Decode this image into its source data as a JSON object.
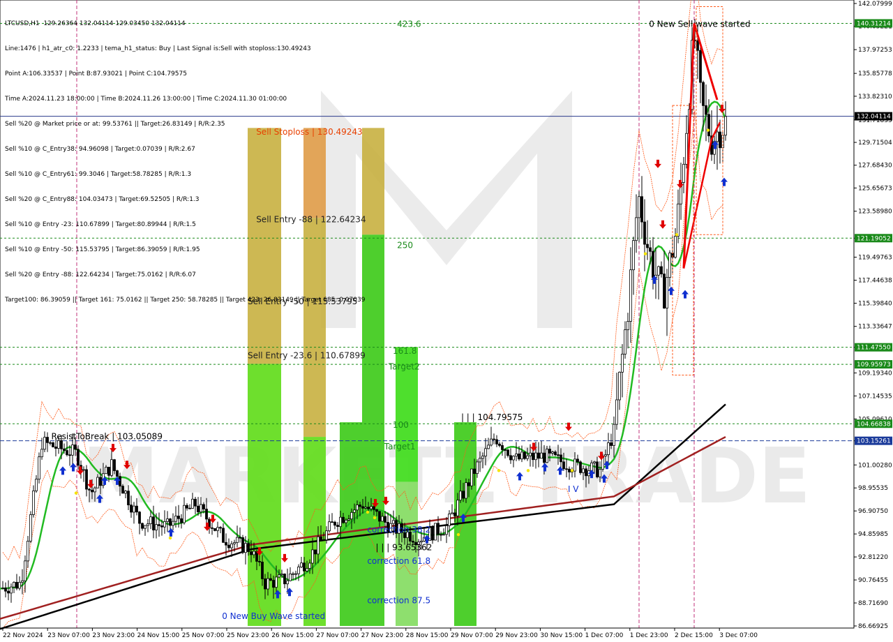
{
  "header": {
    "lines": [
      "LTCUSD,H1  129.26364 132.04114 129.03450 132.04114",
      "Line:1476 | h1_atr_c0: 1.2233 | tema_h1_status: Buy | Last Signal is:Sell with stoploss:130.49243",
      "Point A:106.33537 | Point B:87.93021 | Point C:104.79575",
      "Time A:2024.11.23 18:00:00 | Time B:2024.11.26 13:00:00 | Time C:2024.11.30 01:00:00",
      "Sell %20 @ Market price or at: 99.53761 || Target:26.83149 | R/R:2.35",
      "Sell %10 @ C_Entry38: 94.96098 | Target:0.07039 | R/R:2.67",
      "Sell %10 @ C_Entry61: 99.3046 | Target:58.78285 | R/R:1.3",
      "Sell %20 @ C_Entry88: 104.03473 | Target:69.52505 | R/R:1.3",
      "Sell %10 @ Entry -23: 110.67899 | Target:80.89944 | R/R:1.5",
      "Sell %10 @ Entry -50: 115.53795 | Target:86.39059 | R/R:1.95",
      "Sell %20 @ Entry -88: 122.64234 | Target:75.0162 | R/R:6.07",
      "Target100: 86.39059 || Target 161: 75.0162 || Target 250: 58.78285 || Target 423: 26.83149 || Target 685: 0.07039"
    ]
  },
  "watermark": "MARKETZ TRADE",
  "colors": {
    "up_candle": "#000000",
    "down_candle": "#000000",
    "ma_fast": "#22bb22",
    "ma_slow": "#000000",
    "ma_mid": "#a02020",
    "level_line": "#1a8a1a",
    "current_price_line": "#2a3a8a",
    "sell_arrow": "#e00000",
    "buy_arrow": "#1030d0",
    "zone_orange": "#e8a400",
    "zone_green": "#22cc22",
    "zone_light_green": "#7cf21a"
  },
  "chart_data": {
    "type": "candlestick",
    "symbol": "LTCUSD",
    "timeframe": "H1",
    "ylim": [
      86.66925,
      142.07999
    ],
    "y_ticks": [
      "142.07999",
      "140.05221",
      "137.97253",
      "135.85778",
      "133.82310",
      "131.71835",
      "129.71504",
      "127.68430",
      "125.65673",
      "123.58980",
      "121.19052",
      "119.49763",
      "117.44638",
      "115.39840",
      "113.33647",
      "111.47550",
      "109.19340",
      "107.14535",
      "105.09610",
      "103.15261",
      "101.00280",
      "98.95535",
      "96.90750",
      "94.85985",
      "92.81220",
      "90.76455",
      "88.71690",
      "86.66925"
    ],
    "x_labels": [
      "22 Nov 2024",
      "23 Nov 07:00",
      "23 Nov 23:00",
      "24 Nov 15:00",
      "25 Nov 07:00",
      "25 Nov 23:00",
      "26 Nov 15:00",
      "27 Nov 07:00",
      "27 Nov 23:00",
      "28 Nov 15:00",
      "29 Nov 07:00",
      "29 Nov 23:00",
      "30 Nov 15:00",
      "1 Dec 07:00",
      "1 Dec 23:00",
      "2 Dec 15:00",
      "3 Dec 07:00"
    ],
    "price_tags": [
      {
        "value": 140.31214,
        "label": "140.31214",
        "color": "#1a8a1a"
      },
      {
        "value": 132.04114,
        "label": "132.04114",
        "color": "#000000"
      },
      {
        "value": 121.19052,
        "label": "121.19052",
        "color": "#1a8a1a"
      },
      {
        "value": 111.4755,
        "label": "111.47550",
        "color": "#1a8a1a"
      },
      {
        "value": 109.95973,
        "label": "109.95973",
        "color": "#1a8a1a"
      },
      {
        "value": 104.66838,
        "label": "104.66838",
        "color": "#1a8a1a"
      },
      {
        "value": 103.15261,
        "label": "103.15261",
        "color": "#1a3a9a"
      }
    ],
    "level_lines": [
      140.31214,
      121.19052,
      111.4755,
      109.95973,
      104.66838
    ],
    "current_price": 132.04114,
    "dashed_level": 103.15261,
    "annotations": [
      {
        "text": "423.6",
        "x_frac": 0.465,
        "y": 140.0,
        "color": "#1a8a1a"
      },
      {
        "text": "250",
        "x_frac": 0.465,
        "y": 120.3,
        "color": "#1a8a1a"
      },
      {
        "text": "161.8",
        "x_frac": 0.46,
        "y": 110.9,
        "color": "#1a8a1a"
      },
      {
        "text": "Target2",
        "x_frac": 0.455,
        "y": 109.5,
        "color": "#1a8a1a"
      },
      {
        "text": "100",
        "x_frac": 0.46,
        "y": 104.3,
        "color": "#1a8a1a"
      },
      {
        "text": "Target1",
        "x_frac": 0.45,
        "y": 102.4,
        "color": "#1a8a1a"
      },
      {
        "text": "Sell Stoploss | 130.49243",
        "x_frac": 0.3,
        "y": 130.4,
        "color": "#e84000"
      },
      {
        "text": "Sell Entry -88 | 122.64234",
        "x_frac": 0.3,
        "y": 122.6,
        "color": "#222222"
      },
      {
        "text": "Sell Entry -50 | 115.53795",
        "x_frac": 0.29,
        "y": 115.3,
        "color": "#222222"
      },
      {
        "text": "Sell Entry -23.6 | 110.67899",
        "x_frac": 0.29,
        "y": 110.5,
        "color": "#222222"
      },
      {
        "text": "| | | 104.79575",
        "x_frac": 0.54,
        "y": 105.0,
        "color": "#000000"
      },
      {
        "text": "| | | 93.65362",
        "x_frac": 0.44,
        "y": 93.4,
        "color": "#000000"
      },
      {
        "text": "correction 38.2",
        "x_frac": 0.43,
        "y": 95.0,
        "color": "#1030d0"
      },
      {
        "text": "correction 61.8",
        "x_frac": 0.43,
        "y": 92.2,
        "color": "#1030d0"
      },
      {
        "text": "correction 87.5",
        "x_frac": 0.43,
        "y": 88.7,
        "color": "#1030d0"
      },
      {
        "text": "0 New Sell wave started",
        "x_frac": 0.76,
        "y": 140.0,
        "color": "#000000"
      },
      {
        "text": "0 New Buy Wave started",
        "x_frac": 0.26,
        "y": 87.3,
        "color": "#1030d0"
      },
      {
        "text": "ResistToBreak | 103.05089",
        "x_frac": 0.06,
        "y": 103.3,
        "color": "#000000"
      },
      {
        "text": "I V",
        "x_frac": 0.665,
        "y": 98.6,
        "color": "#1030d0"
      }
    ]
  }
}
